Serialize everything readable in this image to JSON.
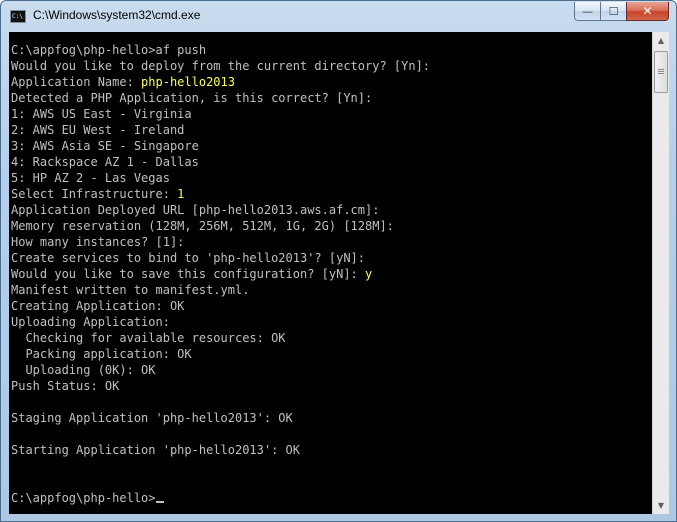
{
  "window": {
    "title": "C:\\Windows\\system32\\cmd.exe",
    "icon": "cmd-icon",
    "icon_text": "C:\\",
    "controls": {
      "minimize": "—",
      "maximize": "☐",
      "close": "✕"
    }
  },
  "console": {
    "lines": [
      [
        {
          "t": "C:\\appfog\\php-hello>af push",
          "h": false
        }
      ],
      [
        {
          "t": "Would you like to deploy from the current directory? [Yn]:",
          "h": false
        }
      ],
      [
        {
          "t": "Application Name: ",
          "h": false
        },
        {
          "t": "php-hello2013",
          "h": true
        }
      ],
      [
        {
          "t": "Detected a PHP Application, is this correct? [Yn]:",
          "h": false
        }
      ],
      [
        {
          "t": "1: AWS US East - Virginia",
          "h": false
        }
      ],
      [
        {
          "t": "2: AWS EU West - Ireland",
          "h": false
        }
      ],
      [
        {
          "t": "3: AWS Asia SE - Singapore",
          "h": false
        }
      ],
      [
        {
          "t": "4: Rackspace AZ 1 - Dallas",
          "h": false
        }
      ],
      [
        {
          "t": "5: HP AZ 2 - Las Vegas",
          "h": false
        }
      ],
      [
        {
          "t": "Select Infrastructure: ",
          "h": false
        },
        {
          "t": "1",
          "h": true
        }
      ],
      [
        {
          "t": "Application Deployed URL [php-hello2013.aws.af.cm]:",
          "h": false
        }
      ],
      [
        {
          "t": "Memory reservation (128M, 256M, 512M, 1G, 2G) [128M]:",
          "h": false
        }
      ],
      [
        {
          "t": "How many instances? [1]:",
          "h": false
        }
      ],
      [
        {
          "t": "Create services to bind to 'php-hello2013'? [yN]:",
          "h": false
        }
      ],
      [
        {
          "t": "Would you like to save this configuration? [yN]: ",
          "h": false
        },
        {
          "t": "y",
          "h": true
        }
      ],
      [
        {
          "t": "Manifest written to manifest.yml.",
          "h": false
        }
      ],
      [
        {
          "t": "Creating Application: OK",
          "h": false
        }
      ],
      [
        {
          "t": "Uploading Application:",
          "h": false
        }
      ],
      [
        {
          "t": "  Checking for available resources: OK",
          "h": false
        }
      ],
      [
        {
          "t": "  Packing application: OK",
          "h": false
        }
      ],
      [
        {
          "t": "  Uploading (0K): OK",
          "h": false
        }
      ],
      [
        {
          "t": "Push Status: OK",
          "h": false
        }
      ],
      [],
      [
        {
          "t": "Staging Application 'php-hello2013': OK",
          "h": false
        }
      ],
      [],
      [
        {
          "t": "Starting Application 'php-hello2013': OK",
          "h": false
        }
      ],
      [],
      [],
      [
        {
          "t": "C:\\appfog\\php-hello>",
          "h": false
        }
      ]
    ],
    "text_color": "#c0c0c0",
    "highlight_color": "#ffff55",
    "background": "#000000"
  },
  "scrollbar": {
    "up_icon": "▲",
    "down_icon": "▼"
  }
}
